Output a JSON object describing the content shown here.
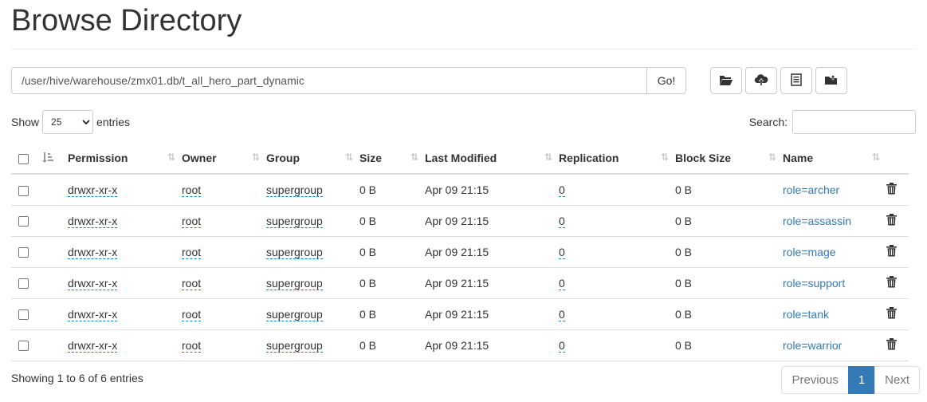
{
  "page_title": "Browse Directory",
  "path_input_value": "/user/hive/warehouse/zmx01.db/t_all_hero_part_dynamic",
  "go_label": "Go!",
  "toolbar_icons": [
    "folder-open-icon",
    "cloud-upload-icon",
    "list-icon",
    "folder-upload-icon"
  ],
  "length_control": {
    "show_label": "Show",
    "selected": "25",
    "entries_label": "entries"
  },
  "search_label": "Search:",
  "table": {
    "headers": [
      "Permission",
      "Owner",
      "Group",
      "Size",
      "Last Modified",
      "Replication",
      "Block Size",
      "Name"
    ],
    "rows": [
      {
        "permission": "drwxr-xr-x",
        "owner": "root",
        "group": "supergroup",
        "size": "0 B",
        "modified": "Apr 09 21:15",
        "replication": "0",
        "block_size": "0 B",
        "name": "role=archer"
      },
      {
        "permission": "drwxr-xr-x",
        "owner": "root",
        "group": "supergroup",
        "size": "0 B",
        "modified": "Apr 09 21:15",
        "replication": "0",
        "block_size": "0 B",
        "name": "role=assassin"
      },
      {
        "permission": "drwxr-xr-x",
        "owner": "root",
        "group": "supergroup",
        "size": "0 B",
        "modified": "Apr 09 21:15",
        "replication": "0",
        "block_size": "0 B",
        "name": "role=mage"
      },
      {
        "permission": "drwxr-xr-x",
        "owner": "root",
        "group": "supergroup",
        "size": "0 B",
        "modified": "Apr 09 21:15",
        "replication": "0",
        "block_size": "0 B",
        "name": "role=support"
      },
      {
        "permission": "drwxr-xr-x",
        "owner": "root",
        "group": "supergroup",
        "size": "0 B",
        "modified": "Apr 09 21:15",
        "replication": "0",
        "block_size": "0 B",
        "name": "role=tank"
      },
      {
        "permission": "drwxr-xr-x",
        "owner": "root",
        "group": "supergroup",
        "size": "0 B",
        "modified": "Apr 09 21:15",
        "replication": "0",
        "block_size": "0 B",
        "name": "role=warrior"
      }
    ]
  },
  "footer": {
    "info": "Showing 1 to 6 of 6 entries",
    "previous": "Previous",
    "page": "1",
    "next": "Next"
  },
  "colors": {
    "link": "#337ab7",
    "active_page": "#337ab7",
    "border": "#dddddd"
  }
}
